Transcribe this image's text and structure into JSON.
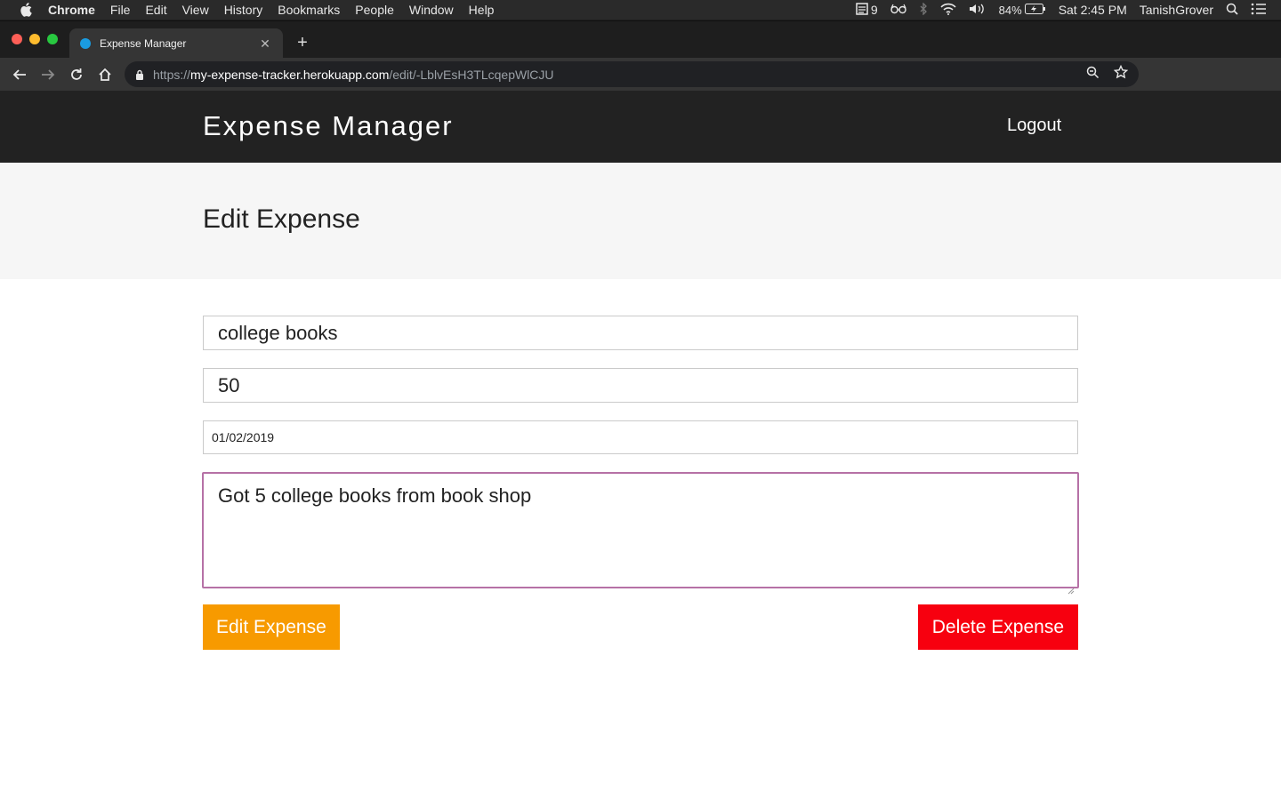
{
  "os_menubar": {
    "app_name": "Chrome",
    "menus": [
      "File",
      "Edit",
      "View",
      "History",
      "Bookmarks",
      "People",
      "Window",
      "Help"
    ],
    "status": {
      "notes_count": "9",
      "battery": "84%",
      "clock": "Sat 2:45 PM",
      "user": "TanishGrover"
    }
  },
  "browser": {
    "tab_title": "Expense Manager",
    "url_scheme": "https://",
    "url_host": "my-expense-tracker.herokuapp.com",
    "url_path": "/edit/-LblvEsH3TLcqepWlCJU"
  },
  "site": {
    "title": "Expense Manager",
    "logout_label": "Logout"
  },
  "page": {
    "title": "Edit Expense"
  },
  "form": {
    "description_value": "college books",
    "amount_value": "50",
    "date_value": "01/02/2019",
    "note_value": "Got 5 college books from book shop",
    "edit_label": "Edit Expense",
    "delete_label": "Delete Expense"
  },
  "colors": {
    "header_bg": "#222222",
    "subheader_bg": "#f6f6f6",
    "edit_button": "#f79a00",
    "delete_button": "#f7000f",
    "focus_border": "#b671a6"
  }
}
